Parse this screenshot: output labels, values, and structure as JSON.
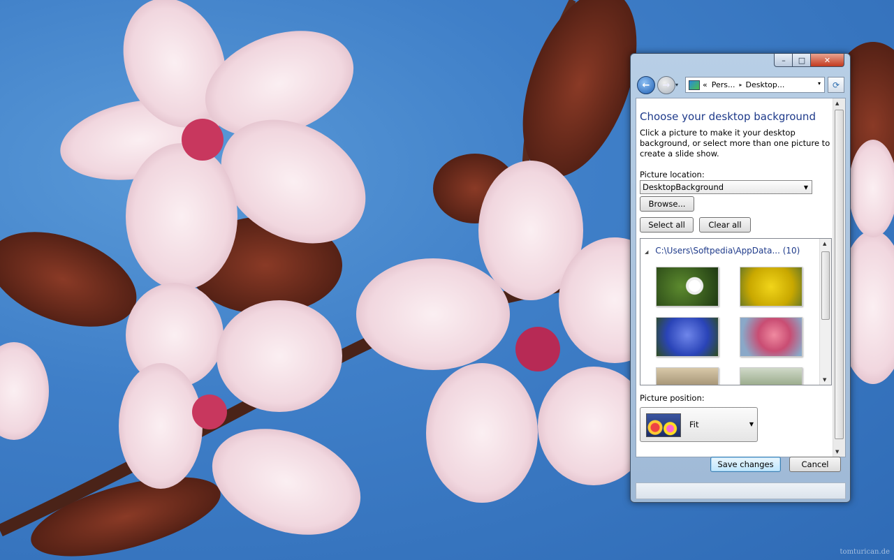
{
  "window": {
    "controls": {
      "minimize": "–",
      "maximize": "□",
      "close": "✕"
    }
  },
  "nav": {
    "back_glyph": "←",
    "forward_glyph": "→",
    "dropdown_glyph": "▾",
    "address_prefix": "«",
    "breadcrumb": [
      "Pers...",
      "Desktop..."
    ],
    "refresh_glyph": "⟳"
  },
  "page": {
    "title": "Choose your desktop background",
    "description": "Click a picture to make it your desktop background, or select more than one picture to create a slide show.",
    "picture_location_label": "Picture location:",
    "picture_location_value": "DesktopBackground",
    "browse_label": "Browse...",
    "select_all_label": "Select all",
    "clear_all_label": "Clear all",
    "gallery_header": "C:\\Users\\Softpedia\\AppData... (10)",
    "thumbnails": [
      "white-blossoms",
      "yellow-forsythia",
      "blue-flowers",
      "pink-blossoms",
      "bee-flower",
      "green-plant"
    ],
    "picture_position_label": "Picture position:",
    "picture_position_value": "Fit",
    "save_label": "Save changes",
    "cancel_label": "Cancel"
  },
  "desktop": {
    "watermark": "tomturican.de"
  },
  "colors": {
    "link_blue": "#1e3a8a",
    "close_red": "#c23a1f",
    "sky_blue": "#3f7fc8"
  }
}
